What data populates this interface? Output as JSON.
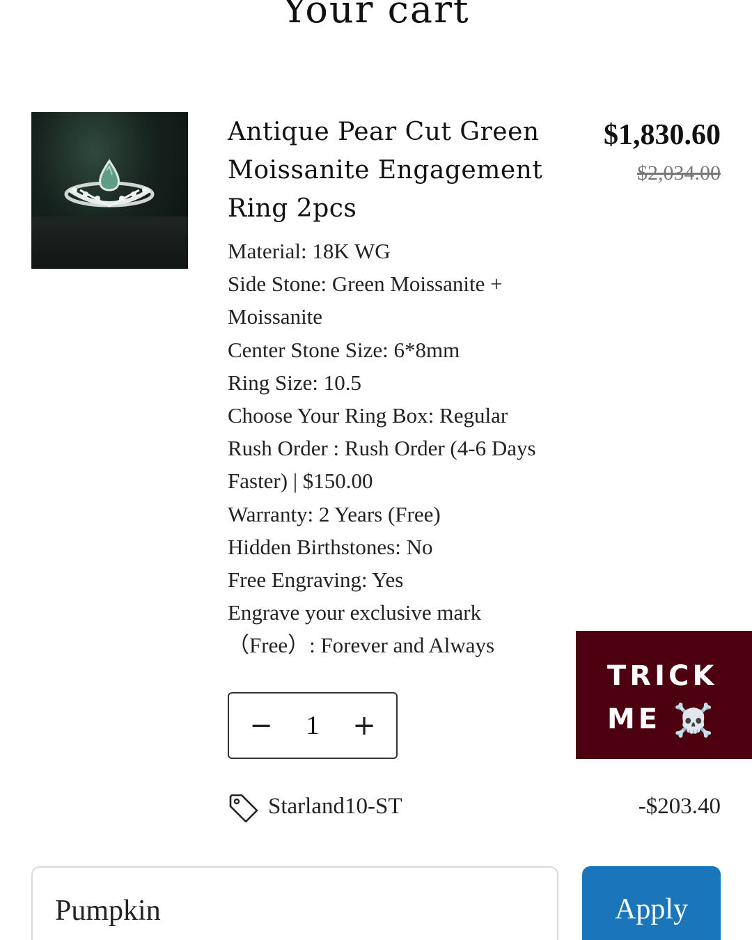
{
  "page": {
    "title": "Your cart"
  },
  "item": {
    "name": "Antique Pear Cut Green Moissanite Engagement Ring 2pcs",
    "price": "$1,830.60",
    "compare_at_price": "$2,034.00",
    "options": [
      "Material: 18K WG",
      "Side Stone: Green Moissanite + Moissanite",
      "Center Stone Size: 6*8mm",
      "Ring Size: 10.5",
      "Choose Your Ring Box: Regular",
      "Rush Order : Rush Order (4-6 Days Faster) | $150.00",
      "Warranty: 2 Years (Free)",
      "Hidden Birthstones: No",
      "Free Engraving: Yes",
      "Engrave your exclusive mark （Free）: Forever and Always"
    ],
    "quantity": {
      "decrease_label": "−",
      "value": "1",
      "increase_label": "+"
    },
    "discount": {
      "code": "Starland10-ST",
      "amount": "-$203.40"
    }
  },
  "promo_badge": {
    "line1": "TRICK",
    "line2": "ME",
    "emoji": "☠️"
  },
  "coupon": {
    "value": "Pumpkin",
    "apply_label": "Apply"
  },
  "colors": {
    "promo_bg": "#4c0010",
    "apply_bg": "#1a75bb",
    "text": "#1a1a1a"
  }
}
